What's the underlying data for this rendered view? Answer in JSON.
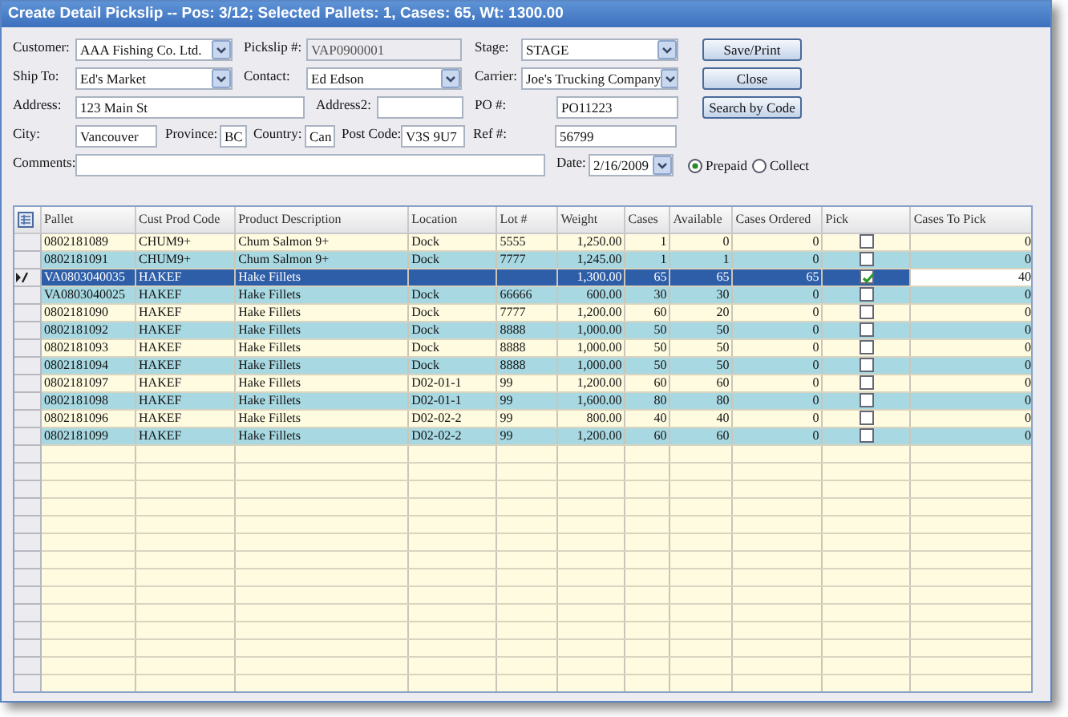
{
  "window": {
    "title": "Create Detail Pickslip -- Pos: 3/12; Selected Pallets: 1, Cases: 65, Wt: 1300.00"
  },
  "form": {
    "rows": [
      [
        {
          "label": "Customer:",
          "kind": "select",
          "value": "AAA Fishing Co. Ltd."
        },
        {
          "label": "Pickslip #:",
          "kind": "readonly",
          "value": "VAP0900001"
        },
        {
          "label": "Stage:",
          "kind": "select",
          "value": "STAGE"
        }
      ],
      [
        {
          "label": "Ship To:",
          "kind": "select",
          "value": "Ed's Market"
        },
        {
          "label": "Contact:",
          "kind": "select",
          "value": "Ed Edson"
        },
        {
          "label": "Carrier:",
          "kind": "select",
          "value": "Joe's Trucking Company"
        }
      ],
      [
        {
          "label": "Address:",
          "kind": "text",
          "value": "123 Main St"
        },
        {
          "label": "Address2:",
          "kind": "text"
        },
        {
          "label": "PO #:",
          "kind": "text",
          "value": "PO11223"
        }
      ],
      [
        {
          "label": "City:",
          "kind": "text",
          "value": "Vancouver"
        },
        {
          "label": "Province:",
          "kind": "text",
          "value": "BC"
        },
        {
          "label": "Country:",
          "kind": "text",
          "value": "Can"
        },
        {
          "label": "Post Code:",
          "kind": "text",
          "value": "V3S 9U7"
        },
        {
          "label": "Ref #:",
          "kind": "text",
          "value": "56799"
        }
      ],
      [
        {
          "label": "Comments:",
          "kind": "text"
        },
        {
          "label": "Date:",
          "kind": "select",
          "value": "2/16/2009"
        },
        {
          "kind": "radio",
          "options": [
            {
              "label": "Prepaid",
              "selected": true
            },
            {
              "label": "Collect",
              "selected": false
            }
          ]
        }
      ]
    ],
    "buttons": [
      "Save/Print",
      "Close",
      "Search by Code"
    ]
  },
  "table": {
    "columns": [
      "Pallet",
      "Cust Prod Code",
      "Product Description",
      "Location",
      "Lot #",
      "Weight",
      "Cases",
      "Available",
      "Cases Ordered",
      "Pick",
      "Cases To Pick"
    ],
    "rows": [
      {
        "pallet": "0802181089",
        "code": "CHUM9+",
        "description": "Chum Salmon 9+",
        "location": "Dock",
        "lot": "5555",
        "weight": "1,250.00",
        "cases": "1",
        "available": "0",
        "ordered": "0",
        "pick": false,
        "to_pick": "0",
        "selected": false
      },
      {
        "pallet": "0802181091",
        "code": "CHUM9+",
        "description": "Chum Salmon 9+",
        "location": "Dock",
        "lot": "7777",
        "weight": "1,245.00",
        "cases": "1",
        "available": "1",
        "ordered": "0",
        "pick": false,
        "to_pick": "0",
        "selected": false
      },
      {
        "pallet": "VA0803040035",
        "code": "HAKEF",
        "description": "Hake Fillets",
        "weight": "1,300.00",
        "cases": "65",
        "available": "65",
        "ordered": "65",
        "pick": true,
        "to_pick": "40",
        "selected": true
      },
      {
        "pallet": "VA0803040025",
        "code": "HAKEF",
        "description": "Hake Fillets",
        "location": "Dock",
        "lot": "66666",
        "weight": "600.00",
        "cases": "30",
        "available": "30",
        "ordered": "0",
        "pick": false,
        "to_pick": "0",
        "selected": false
      },
      {
        "pallet": "0802181090",
        "code": "HAKEF",
        "description": "Hake Fillets",
        "location": "Dock",
        "lot": "7777",
        "weight": "1,200.00",
        "cases": "60",
        "available": "20",
        "ordered": "0",
        "pick": false,
        "to_pick": "0",
        "selected": false
      },
      {
        "pallet": "0802181092",
        "code": "HAKEF",
        "description": "Hake Fillets",
        "location": "Dock",
        "lot": "8888",
        "weight": "1,000.00",
        "cases": "50",
        "available": "50",
        "ordered": "0",
        "pick": false,
        "to_pick": "0",
        "selected": false
      },
      {
        "pallet": "0802181093",
        "code": "HAKEF",
        "description": "Hake Fillets",
        "location": "Dock",
        "lot": "8888",
        "weight": "1,000.00",
        "cases": "50",
        "available": "50",
        "ordered": "0",
        "pick": false,
        "to_pick": "0",
        "selected": false
      },
      {
        "pallet": "0802181094",
        "code": "HAKEF",
        "description": "Hake Fillets",
        "location": "Dock",
        "lot": "8888",
        "weight": "1,000.00",
        "cases": "50",
        "available": "50",
        "ordered": "0",
        "pick": false,
        "to_pick": "0",
        "selected": false
      },
      {
        "pallet": "0802181097",
        "code": "HAKEF",
        "description": "Hake Fillets",
        "location": "D02-01-1",
        "lot": "99",
        "weight": "1,200.00",
        "cases": "60",
        "available": "60",
        "ordered": "0",
        "pick": false,
        "to_pick": "0",
        "selected": false
      },
      {
        "pallet": "0802181098",
        "code": "HAKEF",
        "description": "Hake Fillets",
        "location": "D02-01-1",
        "lot": "99",
        "weight": "1,600.00",
        "cases": "80",
        "available": "80",
        "ordered": "0",
        "pick": false,
        "to_pick": "0",
        "selected": false
      },
      {
        "pallet": "0802181096",
        "code": "HAKEF",
        "description": "Hake Fillets",
        "location": "D02-02-2",
        "lot": "99",
        "weight": "800.00",
        "cases": "40",
        "available": "40",
        "ordered": "0",
        "pick": false,
        "to_pick": "0",
        "selected": false
      },
      {
        "pallet": "0802181099",
        "code": "HAKEF",
        "description": "Hake Fillets",
        "location": "D02-02-2",
        "lot": "99",
        "weight": "1,200.00",
        "cases": "60",
        "available": "60",
        "ordered": "0",
        "pick": false,
        "to_pick": "0",
        "selected": false
      }
    ]
  }
}
